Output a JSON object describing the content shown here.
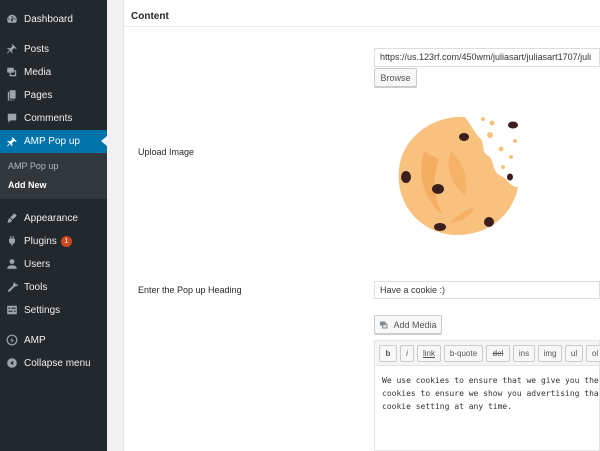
{
  "sidebar": {
    "items": [
      {
        "label": "Dashboard",
        "icon": "dashboard-icon"
      },
      {
        "label": "Posts",
        "icon": "pin-icon"
      },
      {
        "label": "Media",
        "icon": "media-icon"
      },
      {
        "label": "Pages",
        "icon": "page-icon"
      },
      {
        "label": "Comments",
        "icon": "comment-icon"
      },
      {
        "label": "AMP Pop up",
        "icon": "pin-icon",
        "active": true
      }
    ],
    "submenu": [
      {
        "label": "AMP Pop up"
      },
      {
        "label": "Add New",
        "current": true
      }
    ],
    "lower_items": [
      {
        "label": "Appearance",
        "icon": "brush-icon"
      },
      {
        "label": "Plugins",
        "icon": "plugin-icon",
        "badge": "1"
      },
      {
        "label": "Users",
        "icon": "user-icon"
      },
      {
        "label": "Tools",
        "icon": "wrench-icon"
      },
      {
        "label": "Settings",
        "icon": "settings-icon"
      },
      {
        "label": "AMP",
        "icon": "amp-icon"
      },
      {
        "label": "Collapse menu",
        "icon": "collapse-icon"
      }
    ],
    "colors": {
      "background": "#23282d",
      "active": "#0073aa",
      "badge": "#ca4a1f"
    }
  },
  "content": {
    "title": "Content",
    "upload_label": "Upload Image",
    "image_url": "https://us.123rf.com/450wm/juliasart/juliasart1707/juli",
    "browse_label": "Browse",
    "heading_label": "Enter the Pop up Heading",
    "heading_value": "Have a cookie :)",
    "add_media_label": "Add Media",
    "toolbar": [
      "b",
      "i",
      "link",
      "b-quote",
      "del",
      "ins",
      "img",
      "ul",
      "ol"
    ],
    "editor_text": "We use cookies to ensure that we give you the\ncookies to ensure we show you advertising tha\ncookie setting at any time."
  }
}
